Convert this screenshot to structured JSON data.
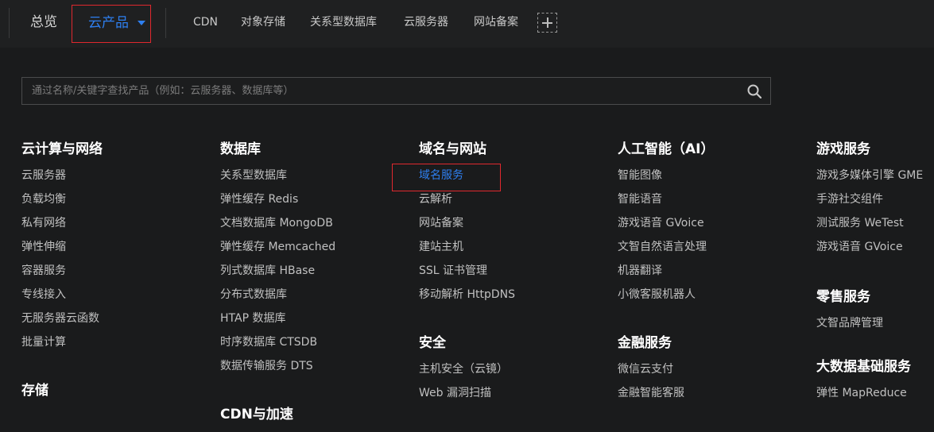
{
  "nav": {
    "overview": "总览",
    "products": "云产品",
    "quick_links": [
      "CDN",
      "对象存储",
      "关系型数据库",
      "云服务器",
      "网站备案"
    ]
  },
  "search": {
    "placeholder": "通过名称/关键字查找产品（例如：云服务器、数据库等）"
  },
  "columns": [
    {
      "groups": [
        {
          "title": "云计算与网络",
          "items": [
            "云服务器",
            "负载均衡",
            "私有网络",
            "弹性伸缩",
            "容器服务",
            "专线接入",
            "无服务器云函数",
            "批量计算"
          ]
        },
        {
          "title": "存储",
          "items": []
        }
      ]
    },
    {
      "groups": [
        {
          "title": "数据库",
          "items": [
            "关系型数据库",
            "弹性缓存 Redis",
            "文档数据库 MongoDB",
            "弹性缓存 Memcached",
            "列式数据库 HBase",
            "分布式数据库",
            "HTAP 数据库",
            "时序数据库 CTSDB",
            "数据传输服务 DTS"
          ]
        },
        {
          "title": "CDN与加速",
          "items": []
        }
      ]
    },
    {
      "groups": [
        {
          "title": "域名与网站",
          "items": [
            "域名服务",
            "云解析",
            "网站备案",
            "建站主机",
            "SSL 证书管理",
            "移动解析 HttpDNS"
          ]
        },
        {
          "title": "安全",
          "items": [
            "主机安全（云镜）",
            "Web 漏洞扫描"
          ]
        }
      ]
    },
    {
      "groups": [
        {
          "title": "人工智能（AI）",
          "items": [
            "智能图像",
            "智能语音",
            "游戏语音 GVoice",
            "文智自然语言处理",
            "机器翻译",
            "小微客服机器人"
          ]
        },
        {
          "title": "金融服务",
          "items": [
            "微信云支付",
            "金融智能客服"
          ]
        }
      ]
    },
    {
      "groups": [
        {
          "title": "游戏服务",
          "items": [
            "游戏多媒体引擎 GME",
            "手游社交组件",
            "测试服务 WeTest",
            "游戏语音 GVoice"
          ]
        },
        {
          "title": "零售服务",
          "items": [
            "文智品牌管理"
          ]
        },
        {
          "title": "大数据基础服务",
          "items": [
            "弹性 MapReduce"
          ]
        }
      ]
    }
  ],
  "icons": {
    "caret": "chevron-down-icon",
    "add": "plus-icon",
    "search": "search-icon"
  },
  "colors": {
    "accent": "#2e7ff0",
    "highlight": "#e0282e",
    "background": "#1a1b1c",
    "topbar": "#1f2021"
  },
  "active_item": "域名服务"
}
